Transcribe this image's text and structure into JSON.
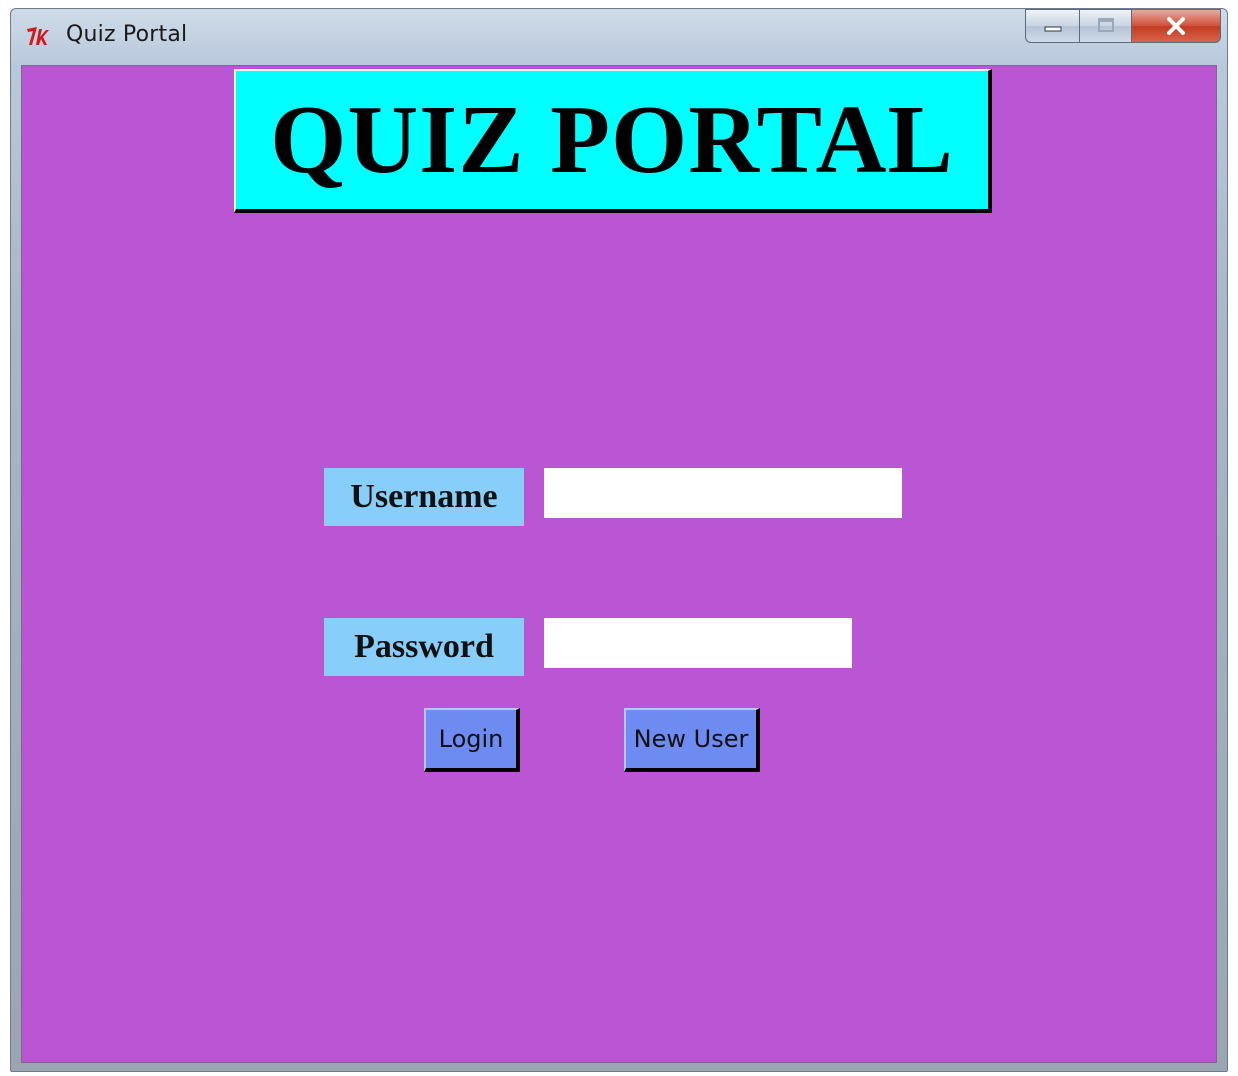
{
  "window": {
    "title": "Quiz Portal",
    "app_icon": "tk-feather-icon",
    "controls": [
      "minimize-icon",
      "maximize-icon",
      "close-icon"
    ]
  },
  "colors": {
    "background": "#ba55d3",
    "banner": "#00ffff",
    "label_bg": "#87cefa",
    "button_bg": "#6d8bf0",
    "entry_bg": "#ffffff"
  },
  "banner": {
    "text": "QUIZ PORTAL"
  },
  "form": {
    "username_label": "Username",
    "username_value": "",
    "password_label": "Password",
    "password_value": ""
  },
  "buttons": {
    "login_label": "Login",
    "new_user_label": "New User"
  }
}
